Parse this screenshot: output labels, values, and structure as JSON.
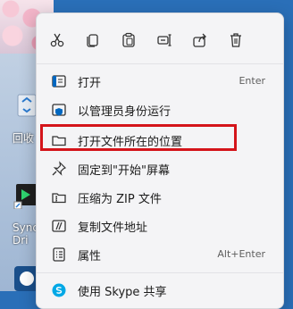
{
  "desktop": {
    "recycle_label": "回收",
    "sync_label_line1": "Sync",
    "sync_label_line2": "Dri"
  },
  "toolbar": {
    "cut": "cut-icon",
    "copy": "copy-icon",
    "paste": "paste-icon",
    "rename": "rename-icon",
    "share": "share-icon",
    "delete": "delete-icon"
  },
  "menu": {
    "items": [
      {
        "label": "打开",
        "shortcut": "Enter",
        "icon": "open-icon"
      },
      {
        "label": "以管理员身份运行",
        "shortcut": "",
        "icon": "shield-icon"
      },
      {
        "label": "打开文件所在的位置",
        "shortcut": "",
        "icon": "folder-icon"
      },
      {
        "label": "固定到\"开始\"屏幕",
        "shortcut": "",
        "icon": "pin-icon"
      },
      {
        "label": "压缩为 ZIP 文件",
        "shortcut": "",
        "icon": "zip-icon"
      },
      {
        "label": "复制文件地址",
        "shortcut": "",
        "icon": "copy-path-icon"
      },
      {
        "label": "属性",
        "shortcut": "Alt+Enter",
        "icon": "properties-icon"
      },
      {
        "label": "使用 Skype 共享",
        "shortcut": "",
        "icon": "skype-icon"
      }
    ]
  },
  "colors": {
    "highlight_border": "#d4141a",
    "menu_bg": "#f4f4f6",
    "accent": "#0067c0"
  }
}
